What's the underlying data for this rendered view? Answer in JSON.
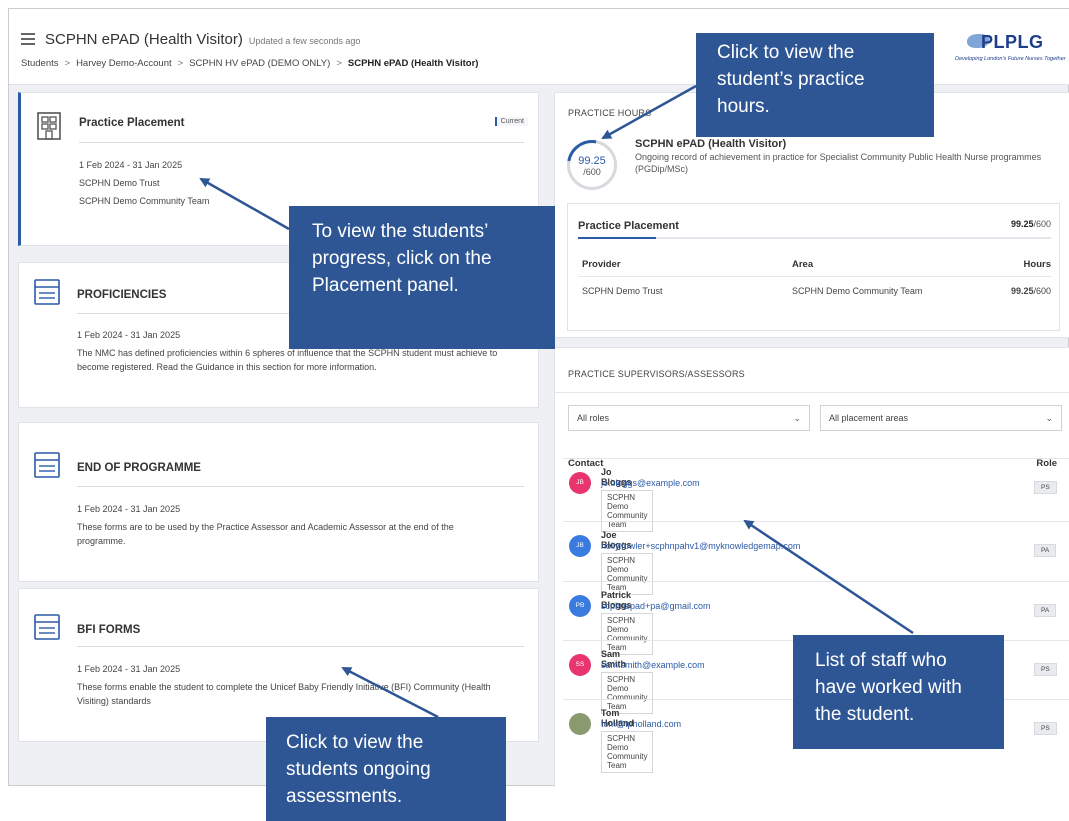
{
  "header": {
    "title": "SCPHN ePAD (Health Visitor)",
    "updated": "Updated a few seconds ago",
    "breadcrumb": [
      "Students",
      "Harvey Demo-Account",
      "SCPHN HV ePAD (DEMO ONLY)",
      "SCPHN ePAD (Health Visitor)"
    ],
    "logo_text": "PLPLG",
    "logo_tagline": "Developing London's Future Nurses Together"
  },
  "panels": [
    {
      "title": "Practice Placement",
      "badge": "Current",
      "dates": "1 Feb 2024 - 31 Jan 2025",
      "line1": "SCPHN Demo Trust",
      "line2": "SCPHN Demo Community Team"
    },
    {
      "title": "PROFICIENCIES",
      "dates": "1 Feb 2024 - 31 Jan 2025",
      "line1": "The NMC has defined proficiencies within 6 spheres of influence that the SCPHN student must achieve to",
      "line2": "become registered. Read the Guidance in this section for more information."
    },
    {
      "title": "END OF PROGRAMME",
      "dates": "1 Feb 2024 - 31 Jan 2025",
      "line1": "These forms are to be used by the Practice Assessor and Academic Assessor at the end of the",
      "line2": "programme."
    },
    {
      "title": "BFI FORMS",
      "dates": "1 Feb 2024 - 31 Jan 2025",
      "line1": "These forms enable the student to complete the Unicef Baby Friendly Initiative (BFI) Community (Health",
      "line2": "Visiting) standards"
    }
  ],
  "practice_hours": {
    "label": "PRACTICE HOURS",
    "value": "99.25",
    "total": "/600",
    "programme_title": "SCPHN ePAD (Health Visitor)",
    "programme_desc": "Ongoing record of achievement in practice for Specialist Community Public Health Nurse programmes (PGDip/MSc)",
    "placement_title": "Practice Placement",
    "placement_value": "99.25",
    "placement_total": "/600",
    "progress_fraction": 0.165,
    "table_headers": [
      "Provider",
      "Area",
      "Hours"
    ],
    "row": {
      "provider": "SCPHN Demo Trust",
      "area": "SCPHN Demo Community Team",
      "hours": "99.25",
      "hours_total": "/600"
    }
  },
  "supervisors": {
    "label": "PRACTICE SUPERVISORS/ASSESSORS",
    "filter_roles": "All roles",
    "filter_areas": "All placement areas",
    "col_contact": "Contact",
    "col_role": "Role",
    "contacts": [
      {
        "initials": "JB",
        "name": "Jo Bloggs",
        "email": "jo.bloggs@example.com",
        "team": "SCPHN Demo Community Team",
        "role": "PS",
        "color": "#e8356d"
      },
      {
        "initials": "JB",
        "name": "Joe Bloggs",
        "email": "holly.fowler+scphnpahv1@myknowledgemap.com",
        "team": "SCPHN Demo Community Team",
        "role": "PA",
        "color": "#3a7be0"
      },
      {
        "initials": "PB",
        "name": "Patrick Bloggs",
        "email": "scphnepad+pa@gmail.com",
        "team": "SCPHN Demo Community Team",
        "role": "PA",
        "color": "#3a7be0"
      },
      {
        "initials": "SS",
        "name": "Sam Smith",
        "email": "sam.smith@example.com",
        "team": "SCPHN Demo Community Team",
        "role": "PS",
        "color": "#e8356d"
      },
      {
        "initials": "",
        "name": "Tom Holland",
        "email": "tom@tpholland.com",
        "team": "SCPHN Demo Community Team",
        "role": "PS",
        "color": "#8a9a6e"
      }
    ]
  },
  "callouts": {
    "hours": [
      "Click to view the",
      "student’s practice",
      "hours."
    ],
    "placement": [
      "To view the students’",
      "progress, click on the",
      "Placement panel."
    ],
    "staff": [
      "List of staff who",
      "have worked with",
      "the student."
    ],
    "assessments": [
      "Click to view the",
      "students ongoing",
      "assessments."
    ]
  },
  "colors": {
    "accent": "#2b5aa7",
    "callout": "#2e5695"
  }
}
